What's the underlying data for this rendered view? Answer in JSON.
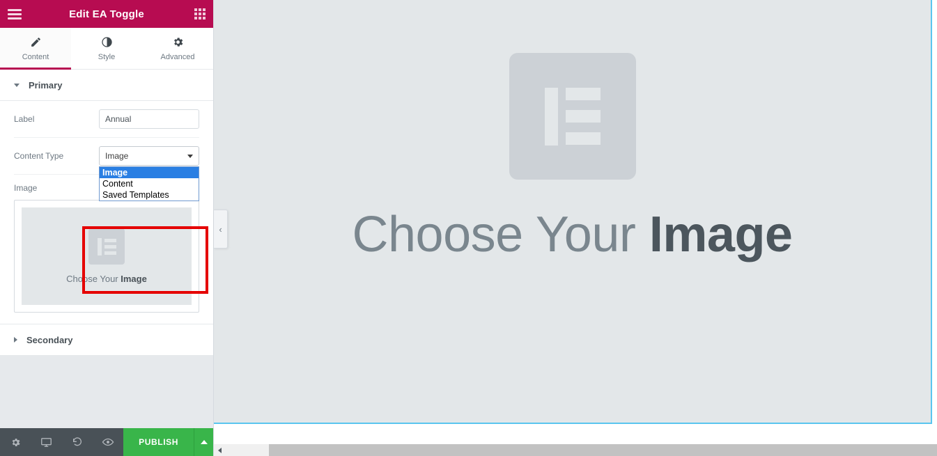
{
  "panel": {
    "header": {
      "title": "Edit EA Toggle",
      "menu_icon": "hamburger-icon",
      "apps_icon": "grid-apps-icon"
    },
    "tabs": [
      {
        "label": "Content",
        "icon": "pencil-icon",
        "active": true
      },
      {
        "label": "Style",
        "icon": "contrast-circle-icon",
        "active": false
      },
      {
        "label": "Advanced",
        "icon": "gear-icon",
        "active": false
      }
    ],
    "sections": [
      {
        "title": "Primary",
        "expanded": true
      },
      {
        "title": "Secondary",
        "expanded": false
      }
    ],
    "controls": {
      "label": {
        "label": "Label",
        "value": "Annual",
        "placeholder": ""
      },
      "content_type": {
        "label": "Content Type",
        "value": "Image",
        "options": [
          "Image",
          "Content",
          "Saved Templates"
        ],
        "selected_index": 0,
        "open": true
      },
      "image": {
        "label": "Image",
        "placeholder_caption_normal": "Choose Your ",
        "placeholder_caption_bold": "Image"
      }
    },
    "footer": {
      "icons": [
        "gear-icon",
        "monitor-icon",
        "history-revert-icon",
        "eye-preview-icon"
      ],
      "publish_label": "PUBLISH",
      "publish_more_icon": "caret-up-icon",
      "publish_color": "#39b54a"
    }
  },
  "canvas": {
    "placeholder_icon": "elementor-logo-icon",
    "heading_normal": "Choose Your ",
    "heading_bold": "Image",
    "selection_border_color": "#59c5ef",
    "background_color": "#e3e7e9"
  },
  "collapse_handle": {
    "icon": "chevron-left-icon",
    "glyph": "‹"
  },
  "scrollbar": {
    "left_arrow_icon": "triangle-left-icon"
  },
  "highlight": {
    "color": "#e50000"
  },
  "theme": {
    "header_color": "#b70c51",
    "accent": "#b70c51",
    "footer_color": "#495157"
  }
}
